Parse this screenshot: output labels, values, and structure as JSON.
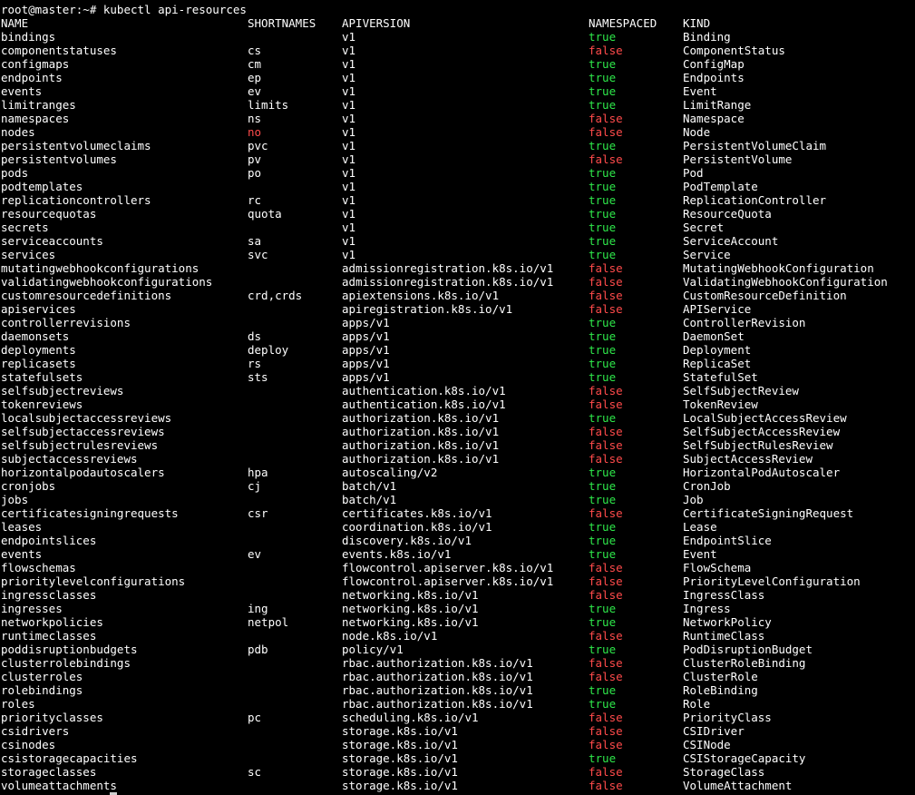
{
  "terminal": {
    "prompt": "root@master:~# kubectl api-resources",
    "colors": {
      "background": "#000000",
      "foreground": "#ffffff",
      "true": "#2ee84a",
      "false": "#ff4b4b"
    },
    "headers": {
      "name": "NAME",
      "shortnames": "SHORTNAMES",
      "apiversion": "APIVERSION",
      "namespaced": "NAMESPACED",
      "kind": "KIND"
    },
    "rows": [
      {
        "name": "bindings",
        "short": "",
        "api": "v1",
        "ns": "true",
        "kind": "Binding"
      },
      {
        "name": "componentstatuses",
        "short": "cs",
        "api": "v1",
        "ns": "false",
        "kind": "ComponentStatus"
      },
      {
        "name": "configmaps",
        "short": "cm",
        "api": "v1",
        "ns": "true",
        "kind": "ConfigMap"
      },
      {
        "name": "endpoints",
        "short": "ep",
        "api": "v1",
        "ns": "true",
        "kind": "Endpoints"
      },
      {
        "name": "events",
        "short": "ev",
        "api": "v1",
        "ns": "true",
        "kind": "Event"
      },
      {
        "name": "limitranges",
        "short": "limits",
        "api": "v1",
        "ns": "true",
        "kind": "LimitRange"
      },
      {
        "name": "namespaces",
        "short": "ns",
        "api": "v1",
        "ns": "false",
        "kind": "Namespace"
      },
      {
        "name": "nodes",
        "short": "no",
        "api": "v1",
        "ns": "false",
        "kind": "Node",
        "short_highlight": true
      },
      {
        "name": "persistentvolumeclaims",
        "short": "pvc",
        "api": "v1",
        "ns": "true",
        "kind": "PersistentVolumeClaim"
      },
      {
        "name": "persistentvolumes",
        "short": "pv",
        "api": "v1",
        "ns": "false",
        "kind": "PersistentVolume"
      },
      {
        "name": "pods",
        "short": "po",
        "api": "v1",
        "ns": "true",
        "kind": "Pod"
      },
      {
        "name": "podtemplates",
        "short": "",
        "api": "v1",
        "ns": "true",
        "kind": "PodTemplate"
      },
      {
        "name": "replicationcontrollers",
        "short": "rc",
        "api": "v1",
        "ns": "true",
        "kind": "ReplicationController"
      },
      {
        "name": "resourcequotas",
        "short": "quota",
        "api": "v1",
        "ns": "true",
        "kind": "ResourceQuota"
      },
      {
        "name": "secrets",
        "short": "",
        "api": "v1",
        "ns": "true",
        "kind": "Secret"
      },
      {
        "name": "serviceaccounts",
        "short": "sa",
        "api": "v1",
        "ns": "true",
        "kind": "ServiceAccount"
      },
      {
        "name": "services",
        "short": "svc",
        "api": "v1",
        "ns": "true",
        "kind": "Service"
      },
      {
        "name": "mutatingwebhookconfigurations",
        "short": "",
        "api": "admissionregistration.k8s.io/v1",
        "ns": "false",
        "kind": "MutatingWebhookConfiguration"
      },
      {
        "name": "validatingwebhookconfigurations",
        "short": "",
        "api": "admissionregistration.k8s.io/v1",
        "ns": "false",
        "kind": "ValidatingWebhookConfiguration"
      },
      {
        "name": "customresourcedefinitions",
        "short": "crd,crds",
        "api": "apiextensions.k8s.io/v1",
        "ns": "false",
        "kind": "CustomResourceDefinition"
      },
      {
        "name": "apiservices",
        "short": "",
        "api": "apiregistration.k8s.io/v1",
        "ns": "false",
        "kind": "APIService"
      },
      {
        "name": "controllerrevisions",
        "short": "",
        "api": "apps/v1",
        "ns": "true",
        "kind": "ControllerRevision"
      },
      {
        "name": "daemonsets",
        "short": "ds",
        "api": "apps/v1",
        "ns": "true",
        "kind": "DaemonSet"
      },
      {
        "name": "deployments",
        "short": "deploy",
        "api": "apps/v1",
        "ns": "true",
        "kind": "Deployment"
      },
      {
        "name": "replicasets",
        "short": "rs",
        "api": "apps/v1",
        "ns": "true",
        "kind": "ReplicaSet"
      },
      {
        "name": "statefulsets",
        "short": "sts",
        "api": "apps/v1",
        "ns": "true",
        "kind": "StatefulSet"
      },
      {
        "name": "selfsubjectreviews",
        "short": "",
        "api": "authentication.k8s.io/v1",
        "ns": "false",
        "kind": "SelfSubjectReview"
      },
      {
        "name": "tokenreviews",
        "short": "",
        "api": "authentication.k8s.io/v1",
        "ns": "false",
        "kind": "TokenReview"
      },
      {
        "name": "localsubjectaccessreviews",
        "short": "",
        "api": "authorization.k8s.io/v1",
        "ns": "true",
        "kind": "LocalSubjectAccessReview"
      },
      {
        "name": "selfsubjectaccessreviews",
        "short": "",
        "api": "authorization.k8s.io/v1",
        "ns": "false",
        "kind": "SelfSubjectAccessReview"
      },
      {
        "name": "selfsubjectrulesreviews",
        "short": "",
        "api": "authorization.k8s.io/v1",
        "ns": "false",
        "kind": "SelfSubjectRulesReview"
      },
      {
        "name": "subjectaccessreviews",
        "short": "",
        "api": "authorization.k8s.io/v1",
        "ns": "false",
        "kind": "SubjectAccessReview"
      },
      {
        "name": "horizontalpodautoscalers",
        "short": "hpa",
        "api": "autoscaling/v2",
        "ns": "true",
        "kind": "HorizontalPodAutoscaler"
      },
      {
        "name": "cronjobs",
        "short": "cj",
        "api": "batch/v1",
        "ns": "true",
        "kind": "CronJob"
      },
      {
        "name": "jobs",
        "short": "",
        "api": "batch/v1",
        "ns": "true",
        "kind": "Job"
      },
      {
        "name": "certificatesigningrequests",
        "short": "csr",
        "api": "certificates.k8s.io/v1",
        "ns": "false",
        "kind": "CertificateSigningRequest"
      },
      {
        "name": "leases",
        "short": "",
        "api": "coordination.k8s.io/v1",
        "ns": "true",
        "kind": "Lease"
      },
      {
        "name": "endpointslices",
        "short": "",
        "api": "discovery.k8s.io/v1",
        "ns": "true",
        "kind": "EndpointSlice"
      },
      {
        "name": "events",
        "short": "ev",
        "api": "events.k8s.io/v1",
        "ns": "true",
        "kind": "Event"
      },
      {
        "name": "flowschemas",
        "short": "",
        "api": "flowcontrol.apiserver.k8s.io/v1",
        "ns": "false",
        "kind": "FlowSchema"
      },
      {
        "name": "prioritylevelconfigurations",
        "short": "",
        "api": "flowcontrol.apiserver.k8s.io/v1",
        "ns": "false",
        "kind": "PriorityLevelConfiguration"
      },
      {
        "name": "ingressclasses",
        "short": "",
        "api": "networking.k8s.io/v1",
        "ns": "false",
        "kind": "IngressClass"
      },
      {
        "name": "ingresses",
        "short": "ing",
        "api": "networking.k8s.io/v1",
        "ns": "true",
        "kind": "Ingress"
      },
      {
        "name": "networkpolicies",
        "short": "netpol",
        "api": "networking.k8s.io/v1",
        "ns": "true",
        "kind": "NetworkPolicy"
      },
      {
        "name": "runtimeclasses",
        "short": "",
        "api": "node.k8s.io/v1",
        "ns": "false",
        "kind": "RuntimeClass"
      },
      {
        "name": "poddisruptionbudgets",
        "short": "pdb",
        "api": "policy/v1",
        "ns": "true",
        "kind": "PodDisruptionBudget"
      },
      {
        "name": "clusterrolebindings",
        "short": "",
        "api": "rbac.authorization.k8s.io/v1",
        "ns": "false",
        "kind": "ClusterRoleBinding"
      },
      {
        "name": "clusterroles",
        "short": "",
        "api": "rbac.authorization.k8s.io/v1",
        "ns": "false",
        "kind": "ClusterRole"
      },
      {
        "name": "rolebindings",
        "short": "",
        "api": "rbac.authorization.k8s.io/v1",
        "ns": "true",
        "kind": "RoleBinding"
      },
      {
        "name": "roles",
        "short": "",
        "api": "rbac.authorization.k8s.io/v1",
        "ns": "true",
        "kind": "Role"
      },
      {
        "name": "priorityclasses",
        "short": "pc",
        "api": "scheduling.k8s.io/v1",
        "ns": "false",
        "kind": "PriorityClass"
      },
      {
        "name": "csidrivers",
        "short": "",
        "api": "storage.k8s.io/v1",
        "ns": "false",
        "kind": "CSIDriver"
      },
      {
        "name": "csinodes",
        "short": "",
        "api": "storage.k8s.io/v1",
        "ns": "false",
        "kind": "CSINode"
      },
      {
        "name": "csistoragecapacities",
        "short": "",
        "api": "storage.k8s.io/v1",
        "ns": "true",
        "kind": "CSIStorageCapacity"
      },
      {
        "name": "storageclasses",
        "short": "sc",
        "api": "storage.k8s.io/v1",
        "ns": "false",
        "kind": "StorageClass"
      },
      {
        "name": "volumeattachments",
        "short": "",
        "api": "storage.k8s.io/v1",
        "ns": "false",
        "kind": "VolumeAttachment"
      }
    ]
  }
}
